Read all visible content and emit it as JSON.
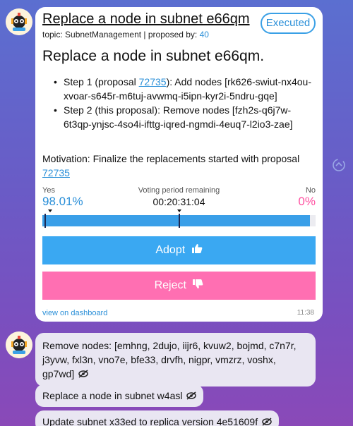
{
  "proposal": {
    "title": "Replace a node in subnet e66qm",
    "status": "Executed",
    "topic_line_prefix": "topic: SubnetManagement | proposed by: ",
    "proposer": "40",
    "heading": "Replace a node in subnet e66qm.",
    "step1_prefix": "Step 1 (proposal ",
    "step1_link": "72735",
    "step1_suffix": "): Add nodes [rk626-swiut-nx4ou-xvoar-s645r-m6tuj-avwmq-i5ipn-kyr2i-5ndru-gqe]",
    "step2": "Step 2 (this proposal): Remove nodes [fzh2s-q6j7w-6t3qp-ynjsc-4so4i-ifttg-iqred-ngmdi-4euq7-l2io3-zae]",
    "motivation_prefix": "Motivation: Finalize the replacements started with proposal ",
    "motivation_link": "72735"
  },
  "voting": {
    "yes_label": "Yes",
    "no_label": "No",
    "remaining_label": "Voting period remaining",
    "yes_value": "98.01%",
    "no_value": "0%",
    "time_remaining": "00:20:31:04",
    "yes_fraction": 0.9801,
    "yes_color": "#3a9fe8",
    "no_color": "#ff4fa0"
  },
  "actions": {
    "adopt_label": "Adopt",
    "reject_label": "Reject",
    "dashboard_link": "view on dashboard",
    "time": "11:38"
  },
  "messages": [
    {
      "text": "Remove nodes: [emhng, 2dujo, iijr6, kvuw2, bojmd, c7n7r, j3yvw, fxl3n, vno7e, bfe33, drvfh, nigpr, vmzrz, voshx, gp7wd]"
    },
    {
      "text": "Replace a node in subnet w4asl"
    },
    {
      "text": "Update subnet x33ed to replica version 4e51609f"
    }
  ]
}
